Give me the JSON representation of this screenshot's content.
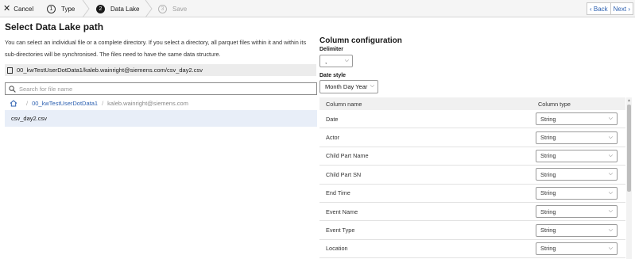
{
  "wizard": {
    "cancel_label": "Cancel",
    "steps": [
      {
        "number": "1",
        "label": "Type",
        "state": "done"
      },
      {
        "number": "2",
        "label": "Data Lake",
        "state": "active"
      },
      {
        "number": "3",
        "label": "Save",
        "state": "disabled"
      }
    ],
    "back_label": "Back",
    "next_label": "Next"
  },
  "left": {
    "title": "Select Data Lake path",
    "description": "You can select an individual file or a complete directory. If you select a directory, all parquet files within it and within its sub-directories will be synchronised. The files need to have the same data structure.",
    "selected_path": "00_kwTestUserDotData1/kaleb.wainright@siemens.com/csv_day2.csv",
    "search_placeholder": "Search for file name",
    "breadcrumb": [
      "00_kwTestUserDotData1",
      "kaleb.wainright@siemens.com"
    ],
    "files": [
      "csv_day2.csv"
    ]
  },
  "right": {
    "title": "Column configuration",
    "delimiter_label": "Delimiter",
    "delimiter_value": ",",
    "date_style_label": "Date style",
    "date_style_value": "Month Day Year",
    "table": {
      "headers": [
        "Column name",
        "Column type"
      ],
      "rows": [
        {
          "name": "Date",
          "type": "String"
        },
        {
          "name": "Actor",
          "type": "String"
        },
        {
          "name": "Child Part Name",
          "type": "String"
        },
        {
          "name": "Child Part SN",
          "type": "String"
        },
        {
          "name": "End Time",
          "type": "String"
        },
        {
          "name": "Event Name",
          "type": "String"
        },
        {
          "name": "Event Type",
          "type": "String"
        },
        {
          "name": "Location",
          "type": "String"
        }
      ]
    }
  },
  "colors": {
    "accent": "#2b5fb0",
    "selected_row": "#e8eef8",
    "topbar": "#f5f5f5"
  }
}
